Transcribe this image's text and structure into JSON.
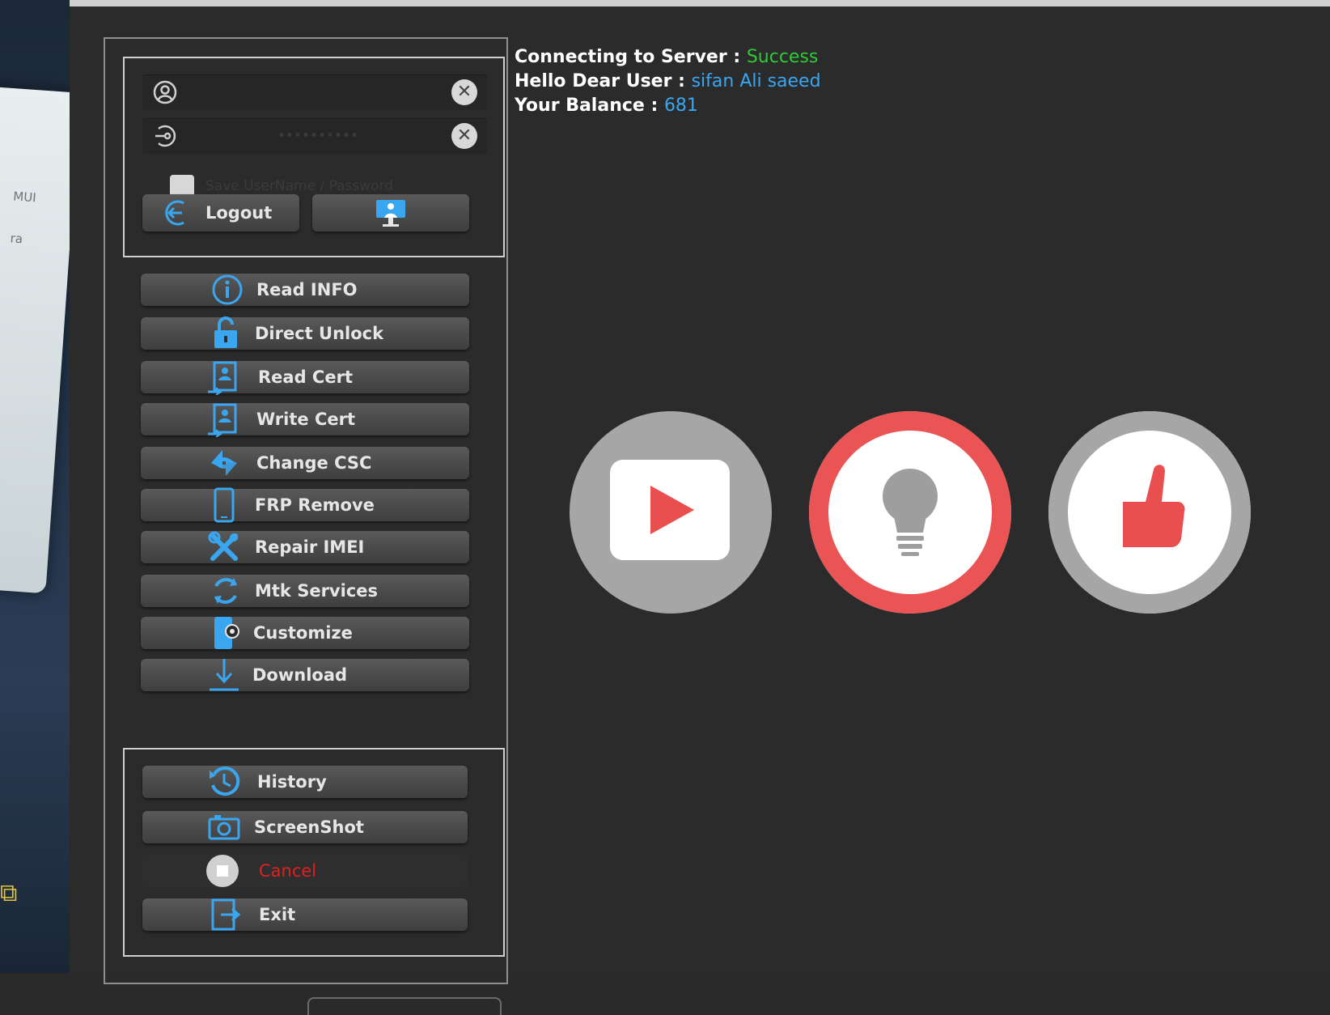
{
  "status": {
    "server_label": "Connecting to Server : ",
    "server_value": "Success",
    "user_label": "Hello Dear User : ",
    "user_value": "sifan Ali saeed",
    "balance_label": "Your Balance : ",
    "balance_value": "681"
  },
  "login": {
    "username_value": "",
    "password_value": "**********",
    "save_label": "Save UserName / Password",
    "logout_label": "Logout"
  },
  "actions": [
    {
      "label": "Read INFO",
      "icon": "info-icon"
    },
    {
      "label": "Direct Unlock",
      "icon": "lock-icon"
    },
    {
      "label": "Read Cert",
      "icon": "certificate-icon"
    },
    {
      "label": "Write Cert",
      "icon": "certificate-icon"
    },
    {
      "label": "Change CSC",
      "icon": "swap-arrows-icon"
    },
    {
      "label": "FRP Remove",
      "icon": "phone-icon"
    },
    {
      "label": "Repair IMEI",
      "icon": "tools-icon"
    },
    {
      "label": "Mtk Services",
      "icon": "sync-icon"
    },
    {
      "label": "Customize",
      "icon": "phone-gear-icon"
    },
    {
      "label": "Download",
      "icon": "download-icon"
    }
  ],
  "tools": [
    {
      "label": "History",
      "icon": "history-icon"
    },
    {
      "label": "ScreenShot",
      "icon": "camera-icon"
    },
    {
      "label": "Cancel",
      "icon": "stop-icon"
    },
    {
      "label": "Exit",
      "icon": "exit-icon"
    }
  ],
  "colors": {
    "success": "#2fc93a",
    "accent_blue": "#3aa6f0",
    "cancel_red": "#e02020",
    "youtube_red": "#ea4f4f"
  },
  "overlay_icons": [
    "youtube-play-icon",
    "lightbulb-icon",
    "thumbs-up-icon"
  ]
}
